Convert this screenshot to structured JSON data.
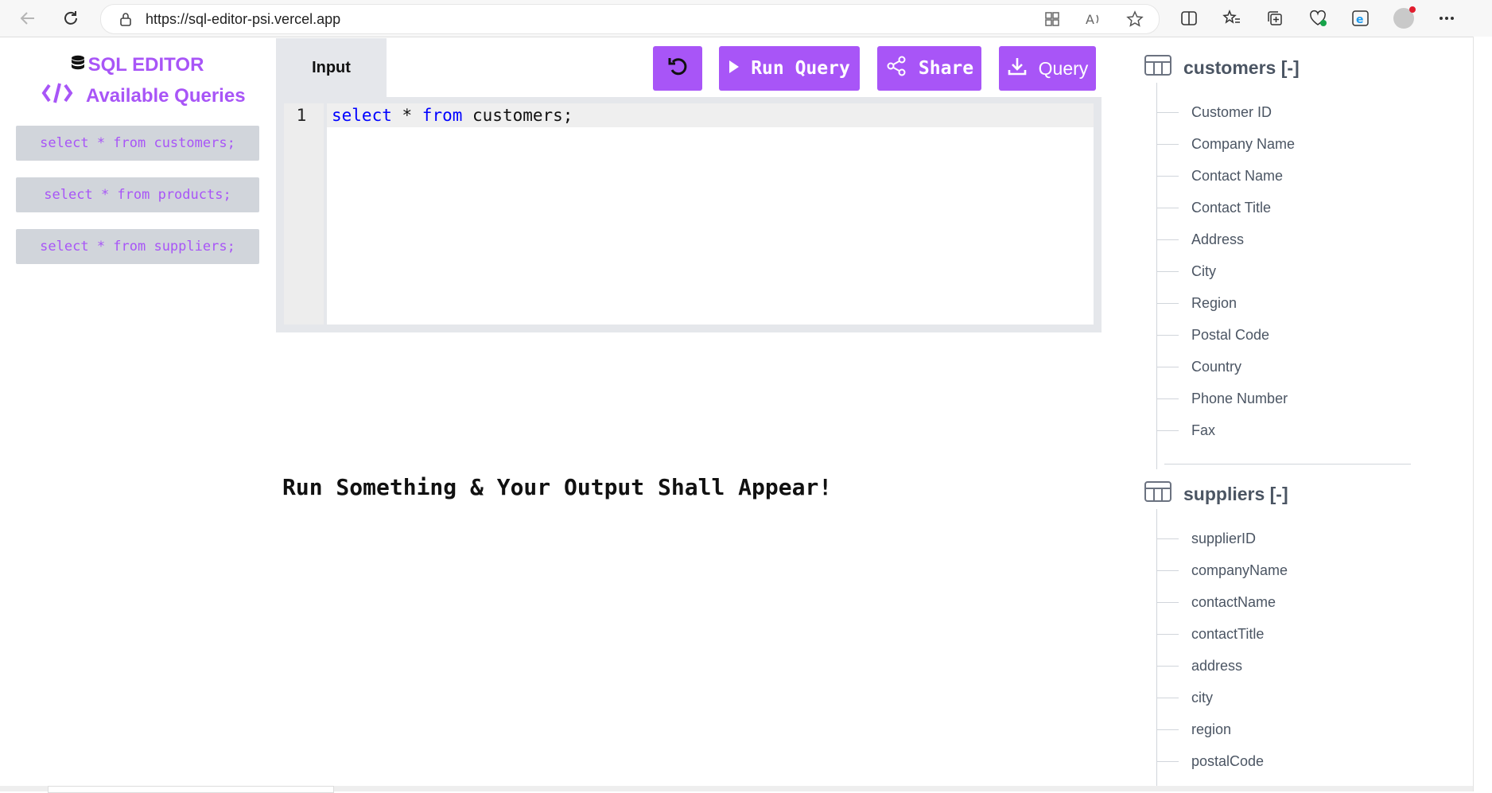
{
  "browser": {
    "url": "https://sql-editor-psi.vercel.app"
  },
  "sidebar": {
    "brand": "SQL EDITOR",
    "available_queries_label": "Available Queries",
    "queries": [
      "select * from customers;",
      "select * from products;",
      "select * from suppliers;"
    ]
  },
  "editor": {
    "tab_label": "Input",
    "actions": {
      "run": "Run Query",
      "share": "Share",
      "download": "Query"
    },
    "line_number": "1",
    "code": {
      "kw1": "select",
      "mid": " * ",
      "kw2": "from",
      "rest": " customers;"
    }
  },
  "output": {
    "placeholder": "Run Something & Your Output Shall Appear!"
  },
  "schema": {
    "tables": [
      {
        "name": "customers [-]",
        "columns": [
          "Customer ID",
          "Company Name",
          "Contact Name",
          "Contact Title",
          "Address",
          "City",
          "Region",
          "Postal Code",
          "Country",
          "Phone Number",
          "Fax"
        ]
      },
      {
        "name": "suppliers [-]",
        "columns": [
          "supplierID",
          "companyName",
          "contactName",
          "contactTitle",
          "address",
          "city",
          "region",
          "postalCode"
        ]
      }
    ]
  },
  "colors": {
    "accent": "#a855f7",
    "query_button_bg": "#d1d5db",
    "schema_text": "#4b5563",
    "keyword": "#0000ff"
  },
  "icons": [
    "back-arrow-icon",
    "refresh-icon",
    "lock-icon",
    "apps-icon",
    "read-aloud-icon",
    "favorite-star-icon",
    "split-screen-icon",
    "favorites-icon",
    "collections-icon",
    "browser-health-icon",
    "edge-icon",
    "profile-avatar",
    "more-icon",
    "database-icon",
    "code-icon",
    "undo-icon",
    "play-icon",
    "share-icon",
    "download-icon",
    "table-icon"
  ]
}
